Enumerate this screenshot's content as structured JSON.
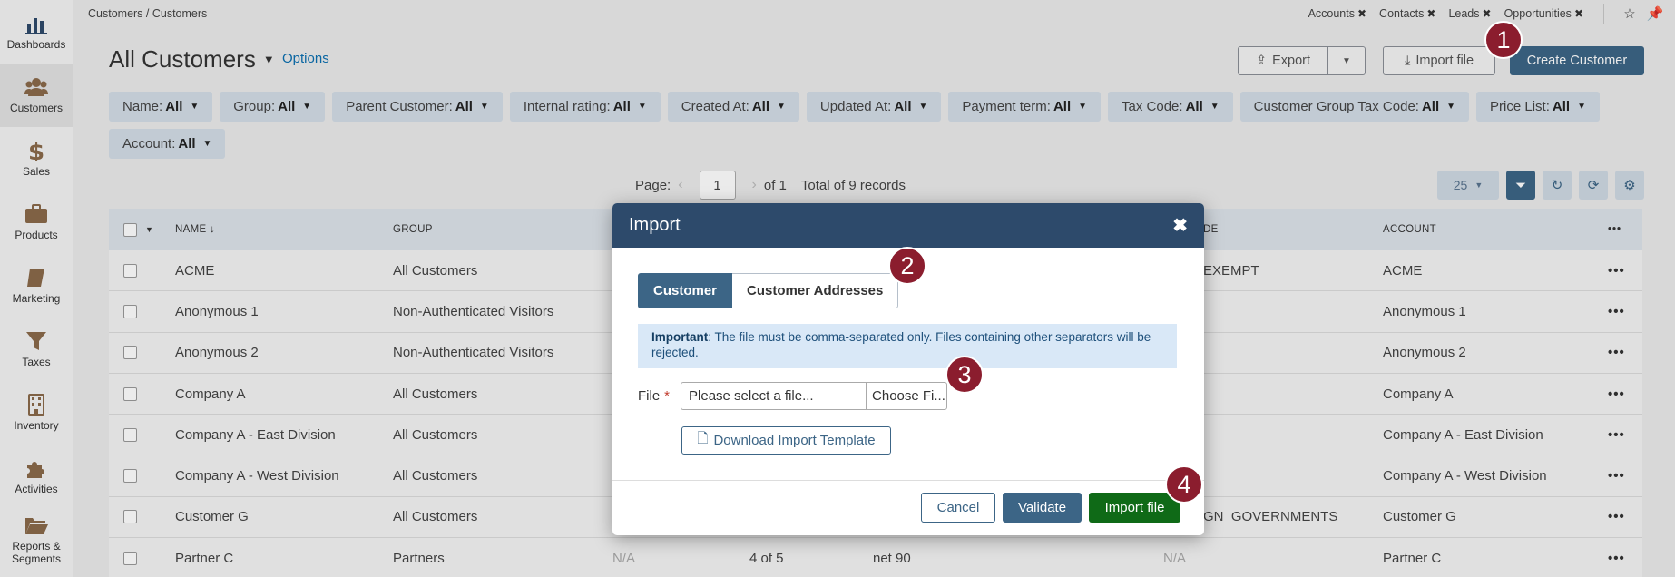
{
  "breadcrumb": "Customers / Customers",
  "pinned_tabs": [
    "Accounts",
    "Contacts",
    "Leads",
    "Opportunities"
  ],
  "sidebar": [
    {
      "label": "Dashboards"
    },
    {
      "label": "Customers"
    },
    {
      "label": "Sales"
    },
    {
      "label": "Products"
    },
    {
      "label": "Marketing"
    },
    {
      "label": "Taxes"
    },
    {
      "label": "Inventory"
    },
    {
      "label": "Activities"
    },
    {
      "label": "Reports &\nSegments"
    }
  ],
  "header": {
    "title": "All Customers",
    "options": "Options",
    "export": "Export",
    "import_file": "Import file",
    "create": "Create Customer"
  },
  "filters": [
    {
      "name": "Name:",
      "value": "All"
    },
    {
      "name": "Group:",
      "value": "All"
    },
    {
      "name": "Parent Customer:",
      "value": "All"
    },
    {
      "name": "Internal rating:",
      "value": "All"
    },
    {
      "name": "Created At:",
      "value": "All"
    },
    {
      "name": "Updated At:",
      "value": "All"
    },
    {
      "name": "Payment term:",
      "value": "All"
    },
    {
      "name": "Tax Code:",
      "value": "All"
    },
    {
      "name": "Customer Group Tax Code:",
      "value": "All"
    },
    {
      "name": "Price List:",
      "value": "All"
    },
    {
      "name": "Account:",
      "value": "All"
    }
  ],
  "pager": {
    "label": "Page:",
    "page": "1",
    "of": "of 1",
    "total": "Total of 9 records",
    "page_size": "25"
  },
  "columns": {
    "name": "NAME",
    "group": "GROUP",
    "tax_code_partial": "DE",
    "account": "ACCOUNT"
  },
  "rows": [
    {
      "name": "ACME",
      "group": "All Customers",
      "tax": "EXEMPT",
      "account": "ACME"
    },
    {
      "name": "Anonymous 1",
      "group": "Non-Authenticated Visitors",
      "tax": "",
      "account": "Anonymous 1"
    },
    {
      "name": "Anonymous 2",
      "group": "Non-Authenticated Visitors",
      "tax": "",
      "account": "Anonymous 2"
    },
    {
      "name": "Company A",
      "group": "All Customers",
      "tax": "",
      "account": "Company A"
    },
    {
      "name": "Company A - East Division",
      "group": "All Customers",
      "tax": "",
      "account": "Company A - East Division"
    },
    {
      "name": "Company A - West Division",
      "group": "All Customers",
      "tax": "",
      "account": "Company A - West Division"
    },
    {
      "name": "Customer G",
      "group": "All Customers",
      "tax": "GN_GOVERNMENTS",
      "account": "Customer G"
    },
    {
      "name": "Partner C",
      "group": "Partners",
      "parent": "N/A",
      "rating": "4 of 5",
      "payment": "net 90",
      "tax": "N/A",
      "account": "Partner C"
    }
  ],
  "modal": {
    "title": "Import",
    "tabs": [
      "Customer",
      "Customer Addresses"
    ],
    "notice_strong": "Important",
    "notice_text": ": The file must be comma-separated only. Files containing other separators will be rejected.",
    "file_label": "File",
    "file_placeholder": "Please select a file...",
    "choose": "Choose Fi...",
    "template": "Download Import Template",
    "cancel": "Cancel",
    "validate": "Validate",
    "import": "Import file"
  },
  "badges": [
    "1",
    "2",
    "3",
    "4"
  ],
  "colors": {
    "primary": "#3c6586",
    "header": "#2d4a6b",
    "success": "#0f6a17",
    "badge": "#8b1d2e"
  }
}
